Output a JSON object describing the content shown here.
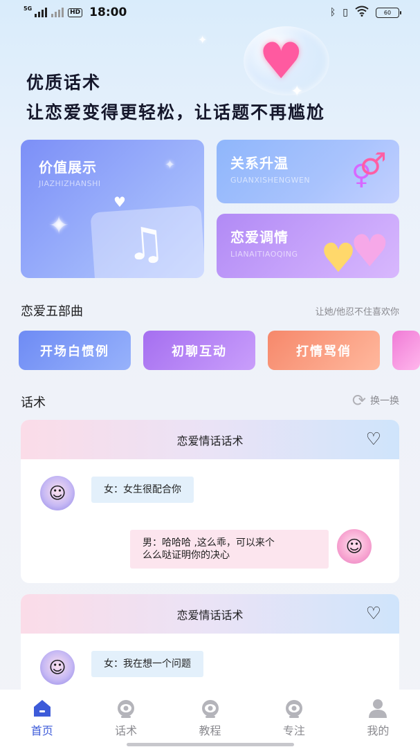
{
  "status_bar": {
    "network": "5G",
    "hd": "HD",
    "time": "18:00",
    "battery": "60"
  },
  "hero": {
    "title": "优质话术",
    "subtitle": "让恋爱变得更轻松，让话题不再尴尬"
  },
  "feature_cards": [
    {
      "title": "价值展示",
      "pinyin": "JIAZHIZHANSHI"
    },
    {
      "title": "关系升温",
      "pinyin": "GUANXISHENGWEN"
    },
    {
      "title": "恋爱调情",
      "pinyin": "LIANAITIAOQING"
    }
  ],
  "series_section": {
    "title": "恋爱五部曲",
    "note": "让她/他忍不住喜欢你"
  },
  "series_items": [
    "开场白惯例",
    "初聊互动",
    "打情骂俏"
  ],
  "talk_section": {
    "title": "话术",
    "refresh_label": "换一换"
  },
  "talk_cards": [
    {
      "title": "恋爱情话话术",
      "female_msg": "女：女生很配合你",
      "male_msg_line1": "男：哈哈哈 ,这么乖，可以来个",
      "male_msg_line2": "么么哒证明你的决心"
    },
    {
      "title": "恋爱情话话术",
      "female_msg": "女：我在想一个问题"
    }
  ],
  "tabbar": [
    {
      "label": "首页",
      "icon": "home-icon",
      "active": true
    },
    {
      "label": "话术",
      "icon": "robot-icon",
      "active": false
    },
    {
      "label": "教程",
      "icon": "robot-icon",
      "active": false
    },
    {
      "label": "专注",
      "icon": "robot-icon",
      "active": false
    },
    {
      "label": "我的",
      "icon": "person-icon",
      "active": false
    }
  ],
  "colors": {
    "accent": "#3d5bd9",
    "card_blue": "#7c8ff7",
    "card_purple": "#b18af5",
    "pill_orange": "#f6886b"
  }
}
